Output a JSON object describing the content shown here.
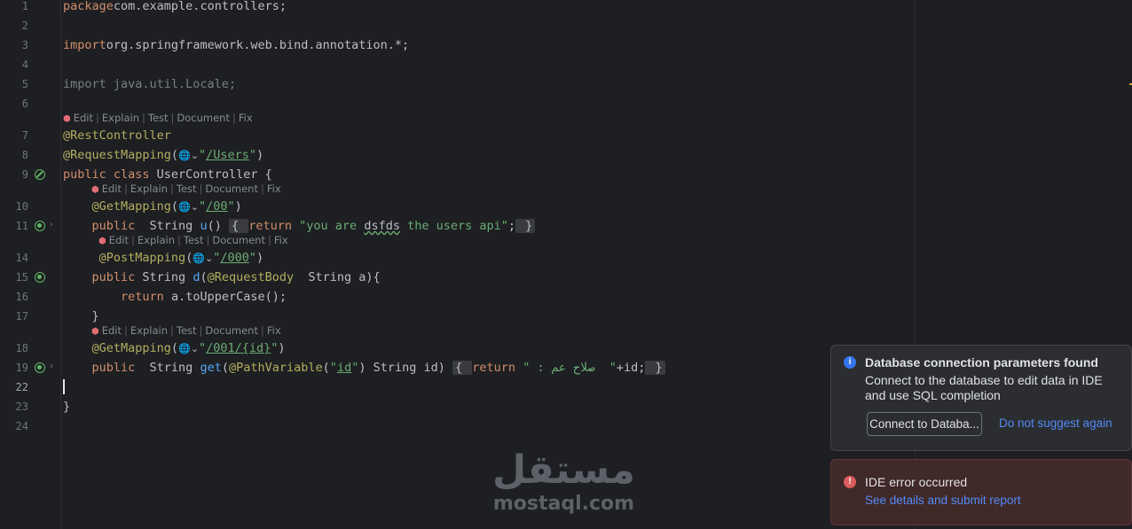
{
  "editor": {
    "line_numbers": [
      "1",
      "2",
      "3",
      "4",
      "5",
      "6",
      "7",
      "8",
      "9",
      "10",
      "11",
      "14",
      "15",
      "16",
      "17",
      "18",
      "19",
      "22",
      "23",
      "24"
    ],
    "active_line": "22",
    "lines": [
      {
        "n": "1",
        "parts": [
          [
            "kw",
            "package"
          ],
          [
            "",
            "com.example.controllers;"
          ]
        ]
      },
      {
        "n": "3",
        "parts": [
          [
            "kw",
            "import"
          ],
          [
            "",
            "org.springframework.web.bind.annotation.*;"
          ]
        ]
      },
      {
        "n": "5",
        "parts": [
          [
            "dim",
            "import java.util.Locale;"
          ]
        ]
      },
      {
        "n": "7",
        "parts": [
          [
            "ann",
            "@RestController"
          ]
        ]
      },
      {
        "n": "8",
        "parts": [
          [
            "ann",
            "@RequestMapping"
          ],
          [
            "",
            "("
          ],
          [
            "globe",
            "🌐⌄"
          ],
          [
            "str",
            "\""
          ],
          [
            "url",
            "/Users"
          ],
          [
            "str",
            "\""
          ],
          [
            "",
            ")"
          ]
        ]
      },
      {
        "n": "9",
        "parts": [
          [
            "kw",
            "public class "
          ],
          [
            "",
            "UserController {"
          ]
        ]
      },
      {
        "n": "10",
        "parts": [
          [
            "",
            "    "
          ],
          [
            "ann",
            "@GetMapping"
          ],
          [
            "",
            "("
          ],
          [
            "globe",
            "🌐⌄"
          ],
          [
            "str",
            "\""
          ],
          [
            "url",
            "/00"
          ],
          [
            "str",
            "\""
          ],
          [
            "",
            ")"
          ]
        ]
      },
      {
        "n": "11",
        "parts": [
          [
            "",
            "    "
          ],
          [
            "kw",
            "public  "
          ],
          [
            "",
            "String "
          ],
          [
            "fn",
            "u"
          ],
          [
            "",
            "() "
          ],
          [
            "fold",
            "{ "
          ],
          [
            "kw",
            "return "
          ],
          [
            "str",
            "\"you are "
          ],
          [
            "typo",
            "dsfds"
          ],
          [
            "str",
            " the users api\""
          ],
          [
            "",
            ";"
          ],
          [
            "fold",
            " }"
          ]
        ]
      },
      {
        "n": "14",
        "parts": [
          [
            "",
            "     "
          ],
          [
            "ann",
            "@PostMapping"
          ],
          [
            "",
            "("
          ],
          [
            "globe",
            "🌐⌄"
          ],
          [
            "str",
            "\""
          ],
          [
            "url",
            "/000"
          ],
          [
            "str",
            "\""
          ],
          [
            "",
            ")"
          ]
        ]
      },
      {
        "n": "15",
        "parts": [
          [
            "",
            "    "
          ],
          [
            "kw",
            "public "
          ],
          [
            "",
            "String "
          ],
          [
            "fn",
            "d"
          ],
          [
            "",
            "("
          ],
          [
            "ann",
            "@RequestBody  "
          ],
          [
            "",
            "String a){"
          ]
        ]
      },
      {
        "n": "16",
        "parts": [
          [
            "",
            "        "
          ],
          [
            "kw",
            "return "
          ],
          [
            "",
            "a.toUpperCase();"
          ]
        ]
      },
      {
        "n": "17",
        "parts": [
          [
            "",
            "    }"
          ]
        ]
      },
      {
        "n": "18",
        "parts": [
          [
            "",
            "    "
          ],
          [
            "ann",
            "@GetMapping"
          ],
          [
            "",
            "("
          ],
          [
            "globe",
            "🌐⌄"
          ],
          [
            "str",
            "\""
          ],
          [
            "url",
            "/001/{id}"
          ],
          [
            "str",
            "\""
          ],
          [
            "",
            ")"
          ]
        ]
      },
      {
        "n": "19",
        "parts": [
          [
            "",
            "    "
          ],
          [
            "kw",
            "public  "
          ],
          [
            "",
            "String "
          ],
          [
            "fn",
            "get"
          ],
          [
            "",
            "("
          ],
          [
            "ann",
            "@PathVariable"
          ],
          [
            "",
            "("
          ],
          [
            "str",
            "\""
          ],
          [
            "url",
            "id"
          ],
          [
            "str",
            "\""
          ],
          [
            "",
            ") String id) "
          ],
          [
            "fold",
            "{ "
          ],
          [
            "kw",
            "return "
          ],
          [
            "str",
            "\" : صلاح عم  \""
          ],
          [
            "",
            "+id;"
          ],
          [
            "fold",
            " }"
          ]
        ]
      },
      {
        "n": "23",
        "parts": [
          [
            "",
            "}"
          ]
        ]
      }
    ],
    "code_lens": {
      "items": [
        "Edit",
        "Explain",
        "Test",
        "Document",
        "Fix"
      ]
    }
  },
  "watermark": {
    "arabic": "مستقل",
    "latin": "mostaql.com"
  },
  "notifications": {
    "db": {
      "title": "Database connection parameters found",
      "body": "Connect to the database to edit data in IDE and use SQL completion",
      "button": "Connect to Databa...",
      "link": "Do not suggest again",
      "icon": "info-icon"
    },
    "error": {
      "title": "IDE error occurred",
      "link": "See details and submit report",
      "icon": "error-icon"
    }
  },
  "colors": {
    "background": "#1e1f22",
    "keyword": "#cf8e6d",
    "annotation": "#b3ae60",
    "string": "#6aab73",
    "function": "#56a8f5",
    "link": "#548af7"
  }
}
